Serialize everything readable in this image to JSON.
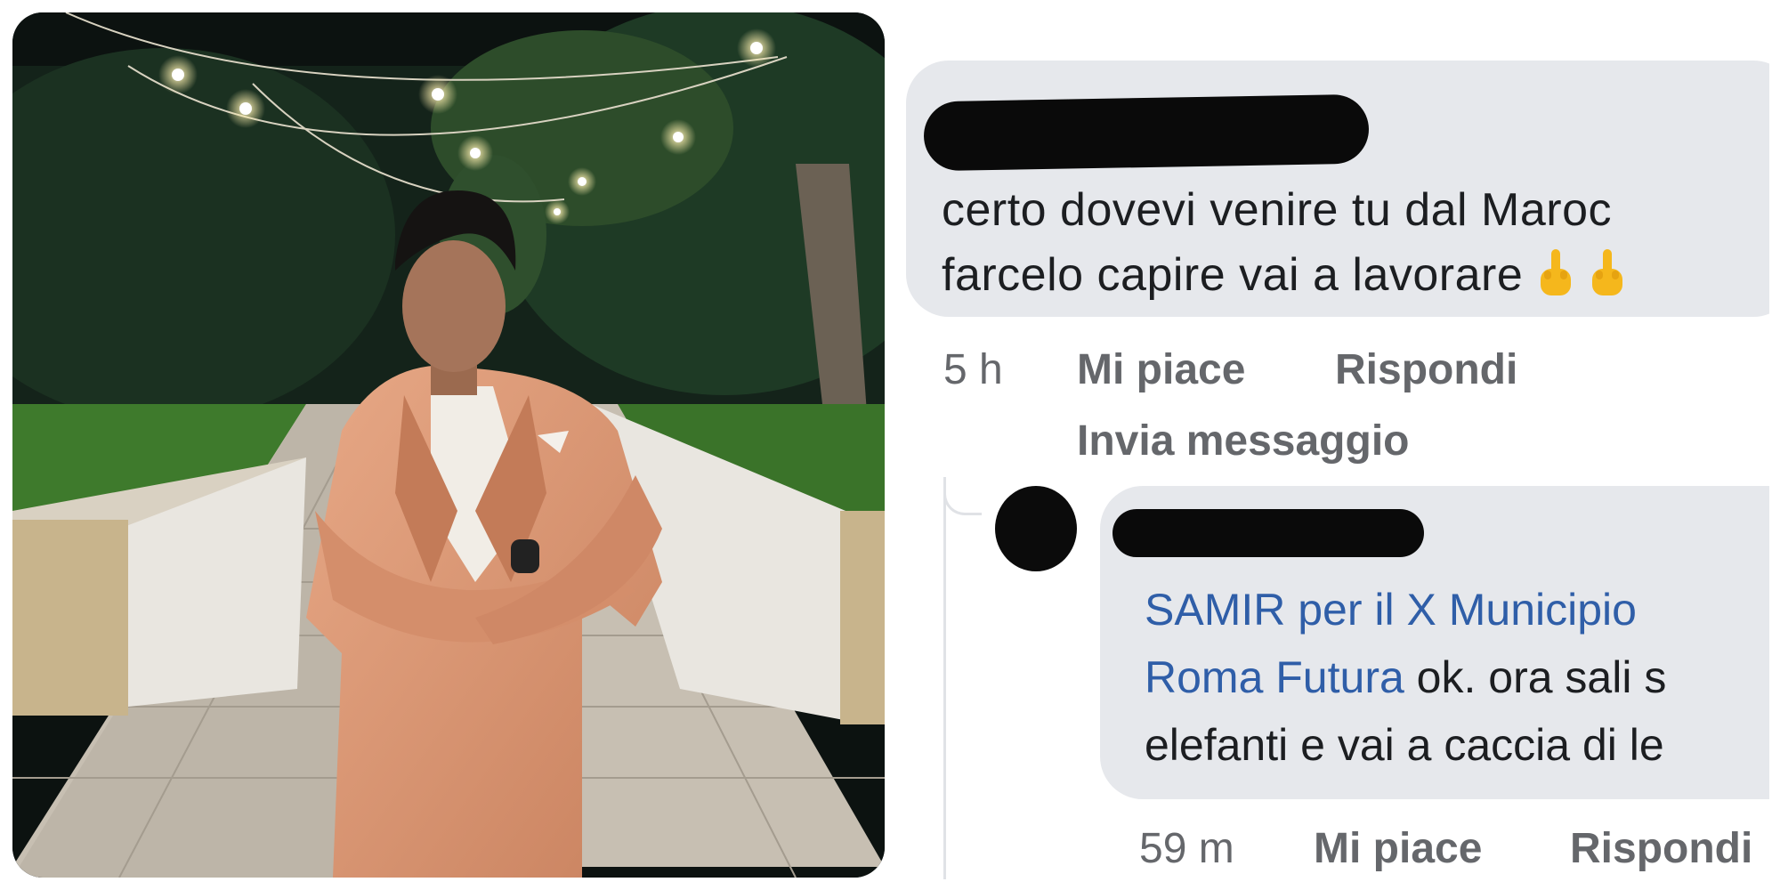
{
  "comment1": {
    "line1": "certo dovevi venire tu  dal Maroc",
    "line2": "farcelo capire vai a lavorare",
    "emoji": [
      "middle-finger-emoji",
      "middle-finger-emoji"
    ],
    "time": "5 h",
    "like": "Mi piace",
    "reply": "Rispondi",
    "message": "Invia messaggio"
  },
  "comment2": {
    "tag_line1": "SAMIR per il X Municipio",
    "tag_line2": "Roma Futura",
    "text_line2": " ok. ora sali s",
    "line3": "elefanti e vai a caccia di le",
    "time": "59 m",
    "like": "Mi piace",
    "reply": "Rispondi"
  },
  "colors": {
    "bubble": "#e6e8ec",
    "mention": "#2f5ea8",
    "meta": "#65676b",
    "suit": "#d99775"
  }
}
